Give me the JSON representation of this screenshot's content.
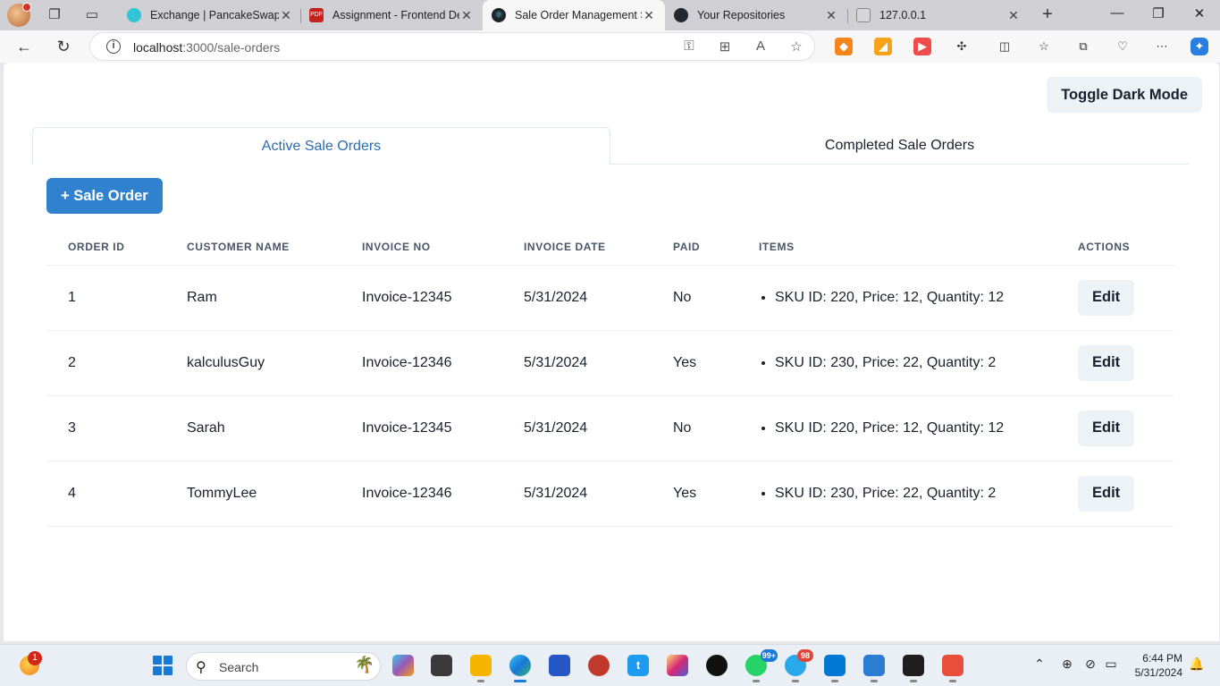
{
  "browser": {
    "tabs": [
      {
        "title": "Exchange | PancakeSwap",
        "active": false
      },
      {
        "title": "Assignment - Frontend De",
        "active": false
      },
      {
        "title": "Sale Order Management S",
        "active": true
      },
      {
        "title": "Your Repositories",
        "active": false
      },
      {
        "title": "127.0.0.1",
        "active": false
      }
    ],
    "address": {
      "host": "localhost",
      "path": ":3000/sale-orders"
    }
  },
  "page": {
    "toggle_dark_mode": "Toggle Dark Mode",
    "tabs": {
      "active": "Active Sale Orders",
      "completed": "Completed Sale Orders"
    },
    "add_button": "+ Sale Order",
    "table": {
      "headers": {
        "order_id": "Order ID",
        "customer": "Customer Name",
        "invoice_no": "Invoice No",
        "invoice_date": "Invoice Date",
        "paid": "Paid",
        "items": "Items",
        "actions": "Actions"
      },
      "rows": [
        {
          "id": "1",
          "customer": "Ram",
          "invoice": "Invoice-12345",
          "date": "5/31/2024",
          "paid": "No",
          "items": [
            "SKU ID: 220, Price: 12, Quantity: 12"
          ],
          "action": "Edit"
        },
        {
          "id": "2",
          "customer": "kalculusGuy",
          "invoice": "Invoice-12346",
          "date": "5/31/2024",
          "paid": "Yes",
          "items": [
            "SKU ID: 230, Price: 22, Quantity: 2"
          ],
          "action": "Edit"
        },
        {
          "id": "3",
          "customer": "Sarah",
          "invoice": "Invoice-12345",
          "date": "5/31/2024",
          "paid": "No",
          "items": [
            "SKU ID: 220, Price: 12, Quantity: 12"
          ],
          "action": "Edit"
        },
        {
          "id": "4",
          "customer": "TommyLee",
          "invoice": "Invoice-12346",
          "date": "5/31/2024",
          "paid": "Yes",
          "items": [
            "SKU ID: 230, Price: 22, Quantity: 2"
          ],
          "action": "Edit"
        }
      ]
    }
  },
  "taskbar": {
    "weather_badge": "1",
    "search_placeholder": "Search",
    "whatsapp_badge": "99+",
    "telegram_badge": "98",
    "time": "6:44 PM",
    "date": "5/31/2024"
  },
  "colors": {
    "accent": "#3182ce",
    "active_tab_text": "#2b6cb0",
    "button_gray": "#edf2f7"
  }
}
